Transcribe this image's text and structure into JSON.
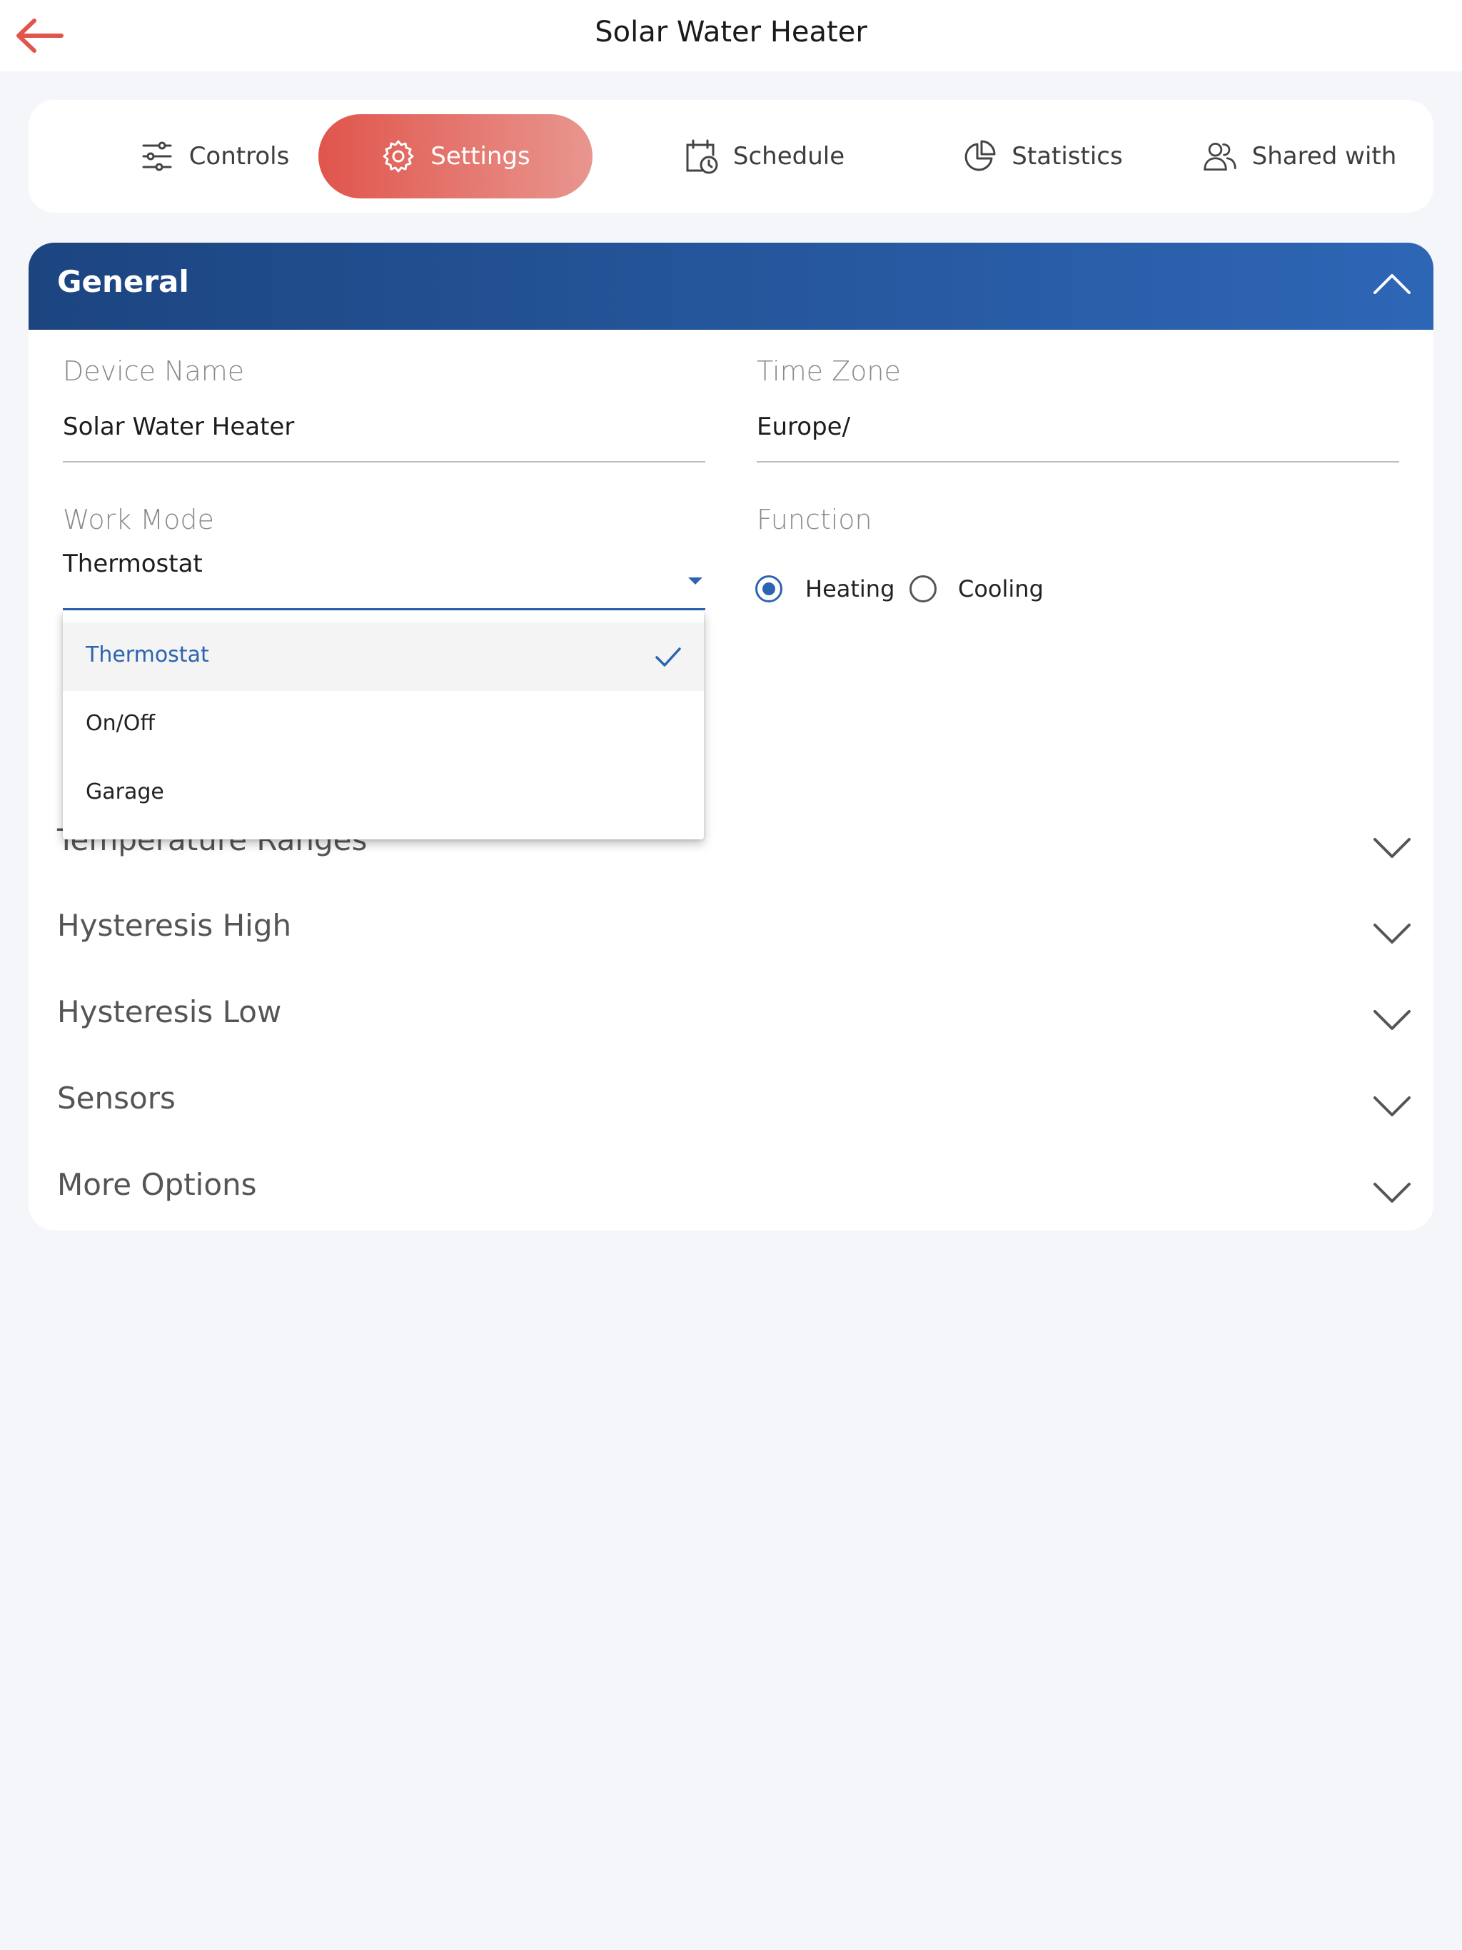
{
  "header": {
    "title": "Solar Water Heater",
    "back_icon": "arrow-left-icon",
    "accent_color": "#e0554c"
  },
  "tabs": [
    {
      "label": "Controls",
      "icon": "sliders-icon"
    },
    {
      "label": "Settings",
      "icon": "gear-icon",
      "active": true
    },
    {
      "label": "Schedule",
      "icon": "calendar-clock-icon"
    },
    {
      "label": "Statistics",
      "icon": "pie-chart-icon"
    },
    {
      "label": "Shared with",
      "icon": "users-icon"
    }
  ],
  "general": {
    "title": "General",
    "header_colors": [
      "#1c4580",
      "#2e66b6"
    ],
    "device_name": {
      "label": "Device Name",
      "value": "Solar Water Heater"
    },
    "time_zone": {
      "label": "Time Zone",
      "value": "Europe/"
    },
    "work_mode": {
      "label": "Work Mode",
      "value": "Thermostat"
    },
    "function": {
      "label": "Function",
      "options": [
        {
          "label": "Heating",
          "checked": true
        },
        {
          "label": "Cooling",
          "checked": false
        }
      ]
    }
  },
  "work_mode_menu": {
    "options": [
      {
        "label": "Thermostat",
        "selected": true
      },
      {
        "label": "On/Off",
        "selected": false
      },
      {
        "label": "Garage",
        "selected": false
      }
    ]
  },
  "accordions": [
    {
      "label": "Temperature Ranges"
    },
    {
      "label": "Hysteresis High"
    },
    {
      "label": "Hysteresis Low"
    },
    {
      "label": "Sensors"
    },
    {
      "label": "More Options"
    }
  ]
}
